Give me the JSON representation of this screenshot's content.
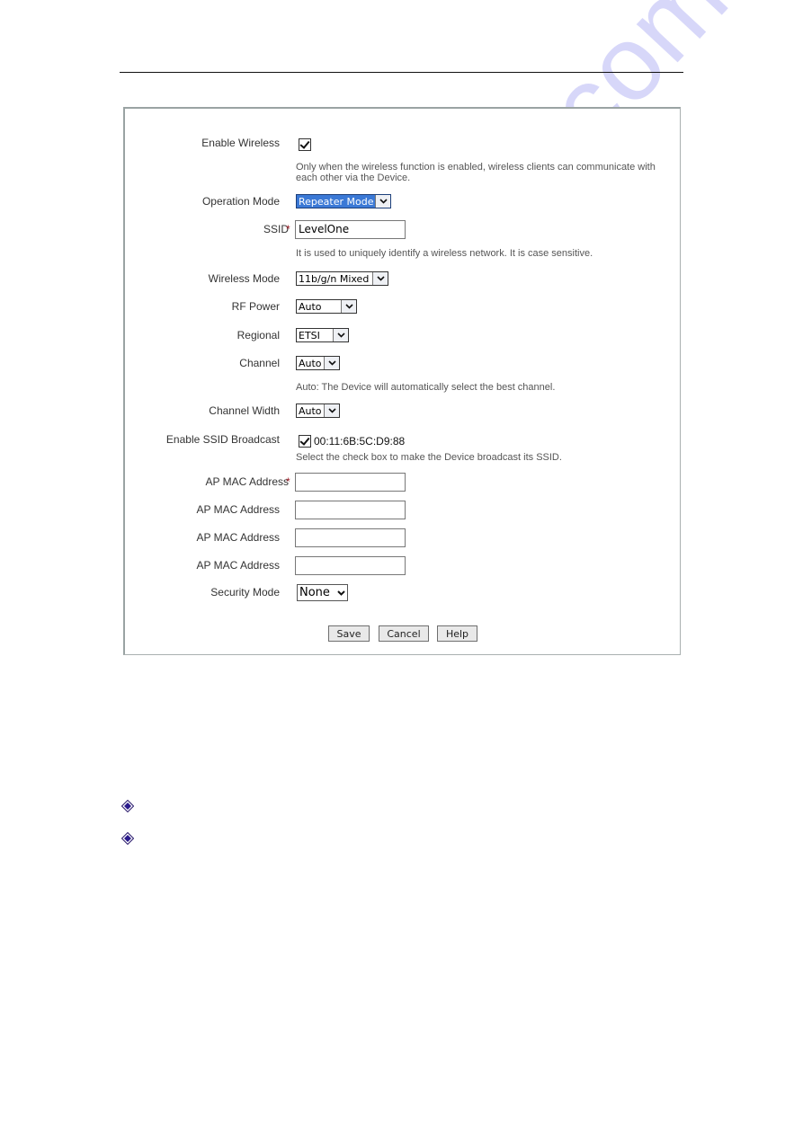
{
  "page": {
    "watermark": "manualshive.com"
  },
  "form": {
    "enable_wireless": {
      "label": "Enable Wireless",
      "checked": true,
      "description_line1": "Only when the wireless function is enabled, wireless clients can communicate with",
      "description_line2": "each other via the Device."
    },
    "operation_mode": {
      "label": "Operation Mode",
      "value": "Repeater Mode"
    },
    "ssid": {
      "label": "SSID",
      "required_mark": "*",
      "value": "LevelOne",
      "description": "It is used to uniquely identify a wireless network. It is case sensitive."
    },
    "wireless_mode": {
      "label": "Wireless Mode",
      "value": "11b/g/n Mixed"
    },
    "rf_power": {
      "label": "RF Power",
      "value": "Auto"
    },
    "regional": {
      "label": "Regional",
      "value": "ETSI"
    },
    "channel": {
      "label": "Channel",
      "value": "Auto",
      "description": "Auto: The Device will automatically select the best channel."
    },
    "channel_width": {
      "label": "Channel Width",
      "value": "Auto"
    },
    "ssid_broadcast": {
      "label": "Enable SSID Broadcast",
      "checked": true,
      "mac": "00:11:6B:5C:D9:88",
      "description": "Select the check box to make the Device broadcast its SSID."
    },
    "ap_mac_addresses": [
      {
        "label": "AP MAC Address",
        "required_mark": "*",
        "value": ""
      },
      {
        "label": "AP MAC Address",
        "required_mark": "",
        "value": ""
      },
      {
        "label": "AP MAC Address",
        "required_mark": "",
        "value": ""
      },
      {
        "label": "AP MAC Address",
        "required_mark": "",
        "value": ""
      }
    ],
    "security_mode": {
      "label": "Security Mode",
      "value": "None"
    }
  },
  "buttons": {
    "save": "Save",
    "cancel": "Cancel",
    "help": "Help"
  },
  "bullets": [
    {
      "icon": "diamond-bullet-icon",
      "text": ""
    },
    {
      "icon": "diamond-bullet-icon",
      "text": ""
    }
  ],
  "colors": {
    "selection_highlight": "#3b79d6",
    "required_mark": "#a0202a",
    "bullet": "#2a1a8c",
    "watermark": "#8282eb"
  }
}
